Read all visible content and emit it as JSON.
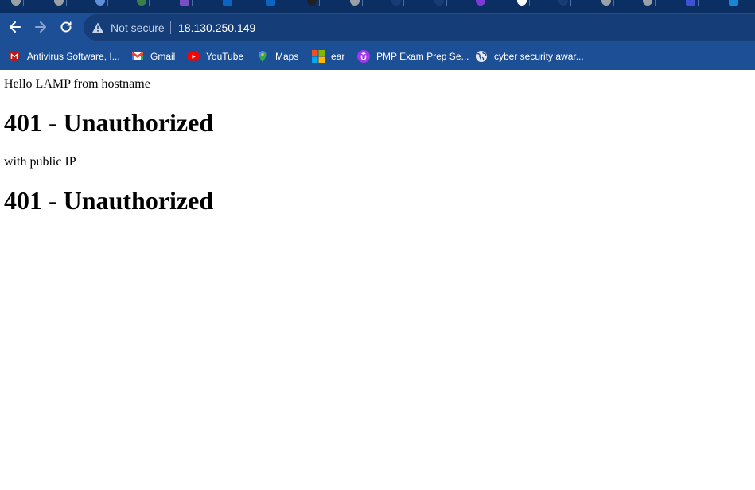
{
  "browser": {
    "tab_favicon_colors": [
      "#9aa0a6",
      "#9aa0a6",
      "#5f8fd8",
      "#3a7f4a",
      "#7b4fc4",
      "#0a66c2",
      "#202124",
      "#9aa0a6",
      "#1a3c74",
      "#1a3c74",
      "#7e3ad9",
      "#ffffff",
      "#1a3c74",
      "#9aa0a6",
      "#9aa0a6",
      "#3f51d4",
      "#1787d4"
    ],
    "security_label": "Not secure",
    "url": "18.130.250.149",
    "bookmarks": [
      {
        "label": "Antivirus Software, I...",
        "icon": "mcafee-shield-icon",
        "color": "#c01818"
      },
      {
        "label": "Gmail",
        "icon": "gmail-icon",
        "color": "#ea4335"
      },
      {
        "label": "YouTube",
        "icon": "youtube-icon",
        "color": "#ff0000"
      },
      {
        "label": "Maps",
        "icon": "maps-pin-icon",
        "color": "#34a853"
      },
      {
        "label": "ear",
        "icon": "microsoft-logo-icon",
        "color": "#f25022"
      },
      {
        "label": "PMP Exam Prep Se...",
        "icon": "udemy-icon",
        "color": "#a435f0"
      },
      {
        "label": "cyber security awar...",
        "icon": "globe-icon",
        "color": "#e8eaed"
      }
    ]
  },
  "page": {
    "line1": "Hello LAMP from hostname",
    "heading1": "401 - Unauthorized",
    "line2": "with public IP",
    "heading2": "401 - Unauthorized"
  }
}
